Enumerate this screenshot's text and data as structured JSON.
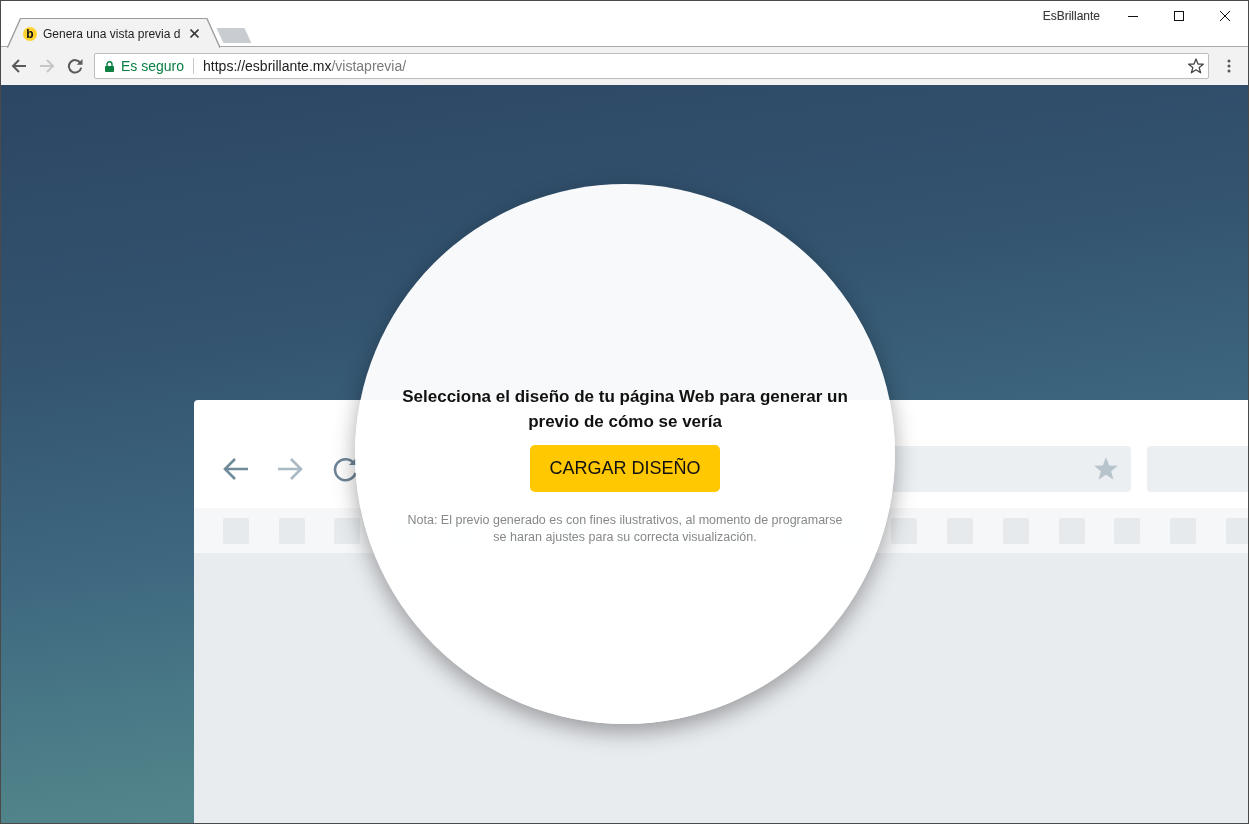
{
  "window": {
    "profile_name": "EsBrillante"
  },
  "tabs": [
    {
      "title": "Genera una vista previa d",
      "favicon": "b",
      "selected": true
    }
  ],
  "toolbar": {
    "nav_buttons": [
      {
        "kind": "back",
        "disabled": false
      },
      {
        "kind": "forward",
        "disabled": true
      },
      {
        "kind": "reload",
        "disabled": false
      }
    ],
    "address_bar": {
      "security_label": "Es seguro",
      "url_origin": "https://esbrillante.mx",
      "url_path": "/vistaprevia/",
      "bookmarked": false
    }
  },
  "dialog": {
    "title": "Selecciona el diseño de tu página Web para generar un previo de cómo se vería",
    "button": "CARGAR DISEÑO",
    "note": "Nota: El previo generado es con fines ilustrativos, al momento de programarse se haran ajustes para su correcta visualización."
  }
}
